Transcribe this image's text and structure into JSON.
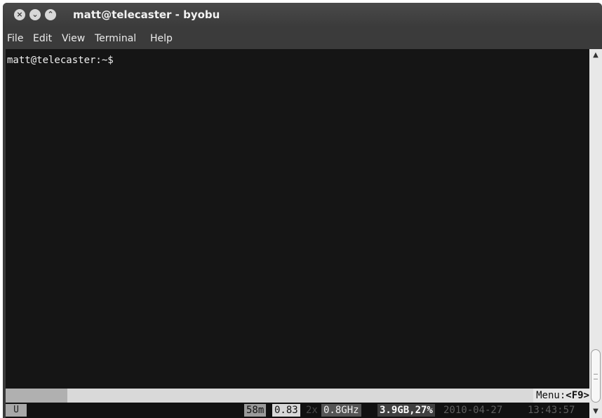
{
  "window": {
    "title": "matt@telecaster - byobu",
    "controls": [
      {
        "name": "close-button",
        "glyph": "×"
      },
      {
        "name": "minimize-button",
        "glyph": "⌄"
      },
      {
        "name": "maximize-button",
        "glyph": "⌃"
      }
    ]
  },
  "menubar": {
    "items": [
      "File",
      "Edit",
      "View",
      "Terminal",
      "Help"
    ]
  },
  "terminal": {
    "prompt": "matt@telecaster:~$"
  },
  "byobu": {
    "menu_hint_prefix": "Menu:",
    "menu_hint_key": "<F9>",
    "u_badge": "U",
    "uptime": "58m",
    "load": "0.83",
    "cpu_count": "2x",
    "cpu_freq": "0.8GHz",
    "memory": "3.9GB,27%",
    "date": "2010-04-27",
    "time": "13:43:57"
  },
  "scrollbar": {
    "up_icon": "▲",
    "down_icon": "▼"
  }
}
